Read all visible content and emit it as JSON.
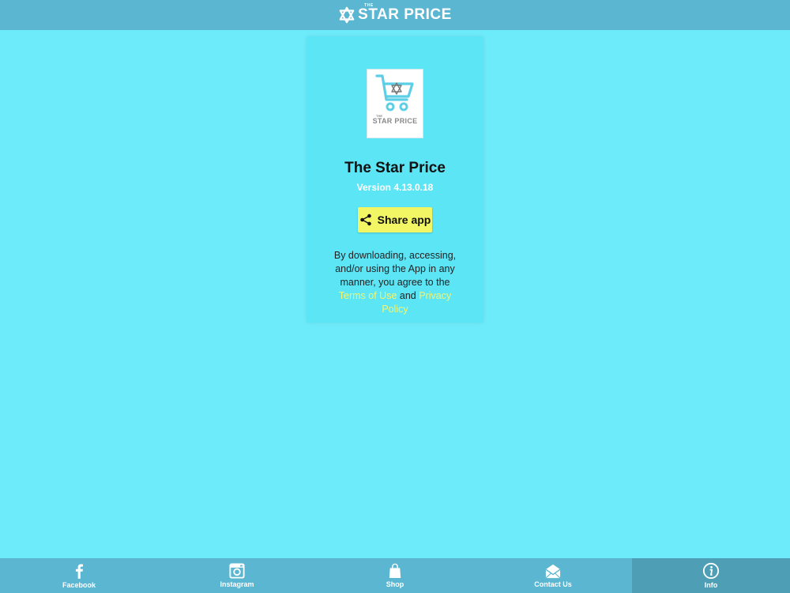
{
  "header": {
    "logo_small": "THE",
    "logo_text": "STAR PRICE",
    "logo_icon": "star-of-david-icon"
  },
  "card": {
    "icon": {
      "small": "THE",
      "caption": "STAR PRICE",
      "icon": "shopping-cart-icon"
    },
    "app_name": "The Star Price",
    "version": "Version 4.13.0.18",
    "share_label": "Share app",
    "share_icon": "share-icon",
    "legal": {
      "prefix": "By downloading, accessing, and/or using the App in any manner, you agree to the ",
      "terms_link": "Terms of Use",
      "middle": " and ",
      "privacy_link": "Privacy Policy"
    }
  },
  "nav": {
    "items": [
      {
        "label": "Facebook",
        "icon": "facebook-icon"
      },
      {
        "label": "Instagram",
        "icon": "instagram-icon"
      },
      {
        "label": "Shop",
        "icon": "shopping-bag-icon"
      },
      {
        "label": "Contact Us",
        "icon": "envelope-icon"
      },
      {
        "label": "Info",
        "icon": "info-icon"
      }
    ],
    "active": "Info"
  },
  "colors": {
    "background": "#6EEBFA",
    "bar": "#5BB6D1",
    "card": "#5CE5F5",
    "button": "#F2F564",
    "link": "#F5F56C",
    "active_tab": "#4E9FB6"
  }
}
